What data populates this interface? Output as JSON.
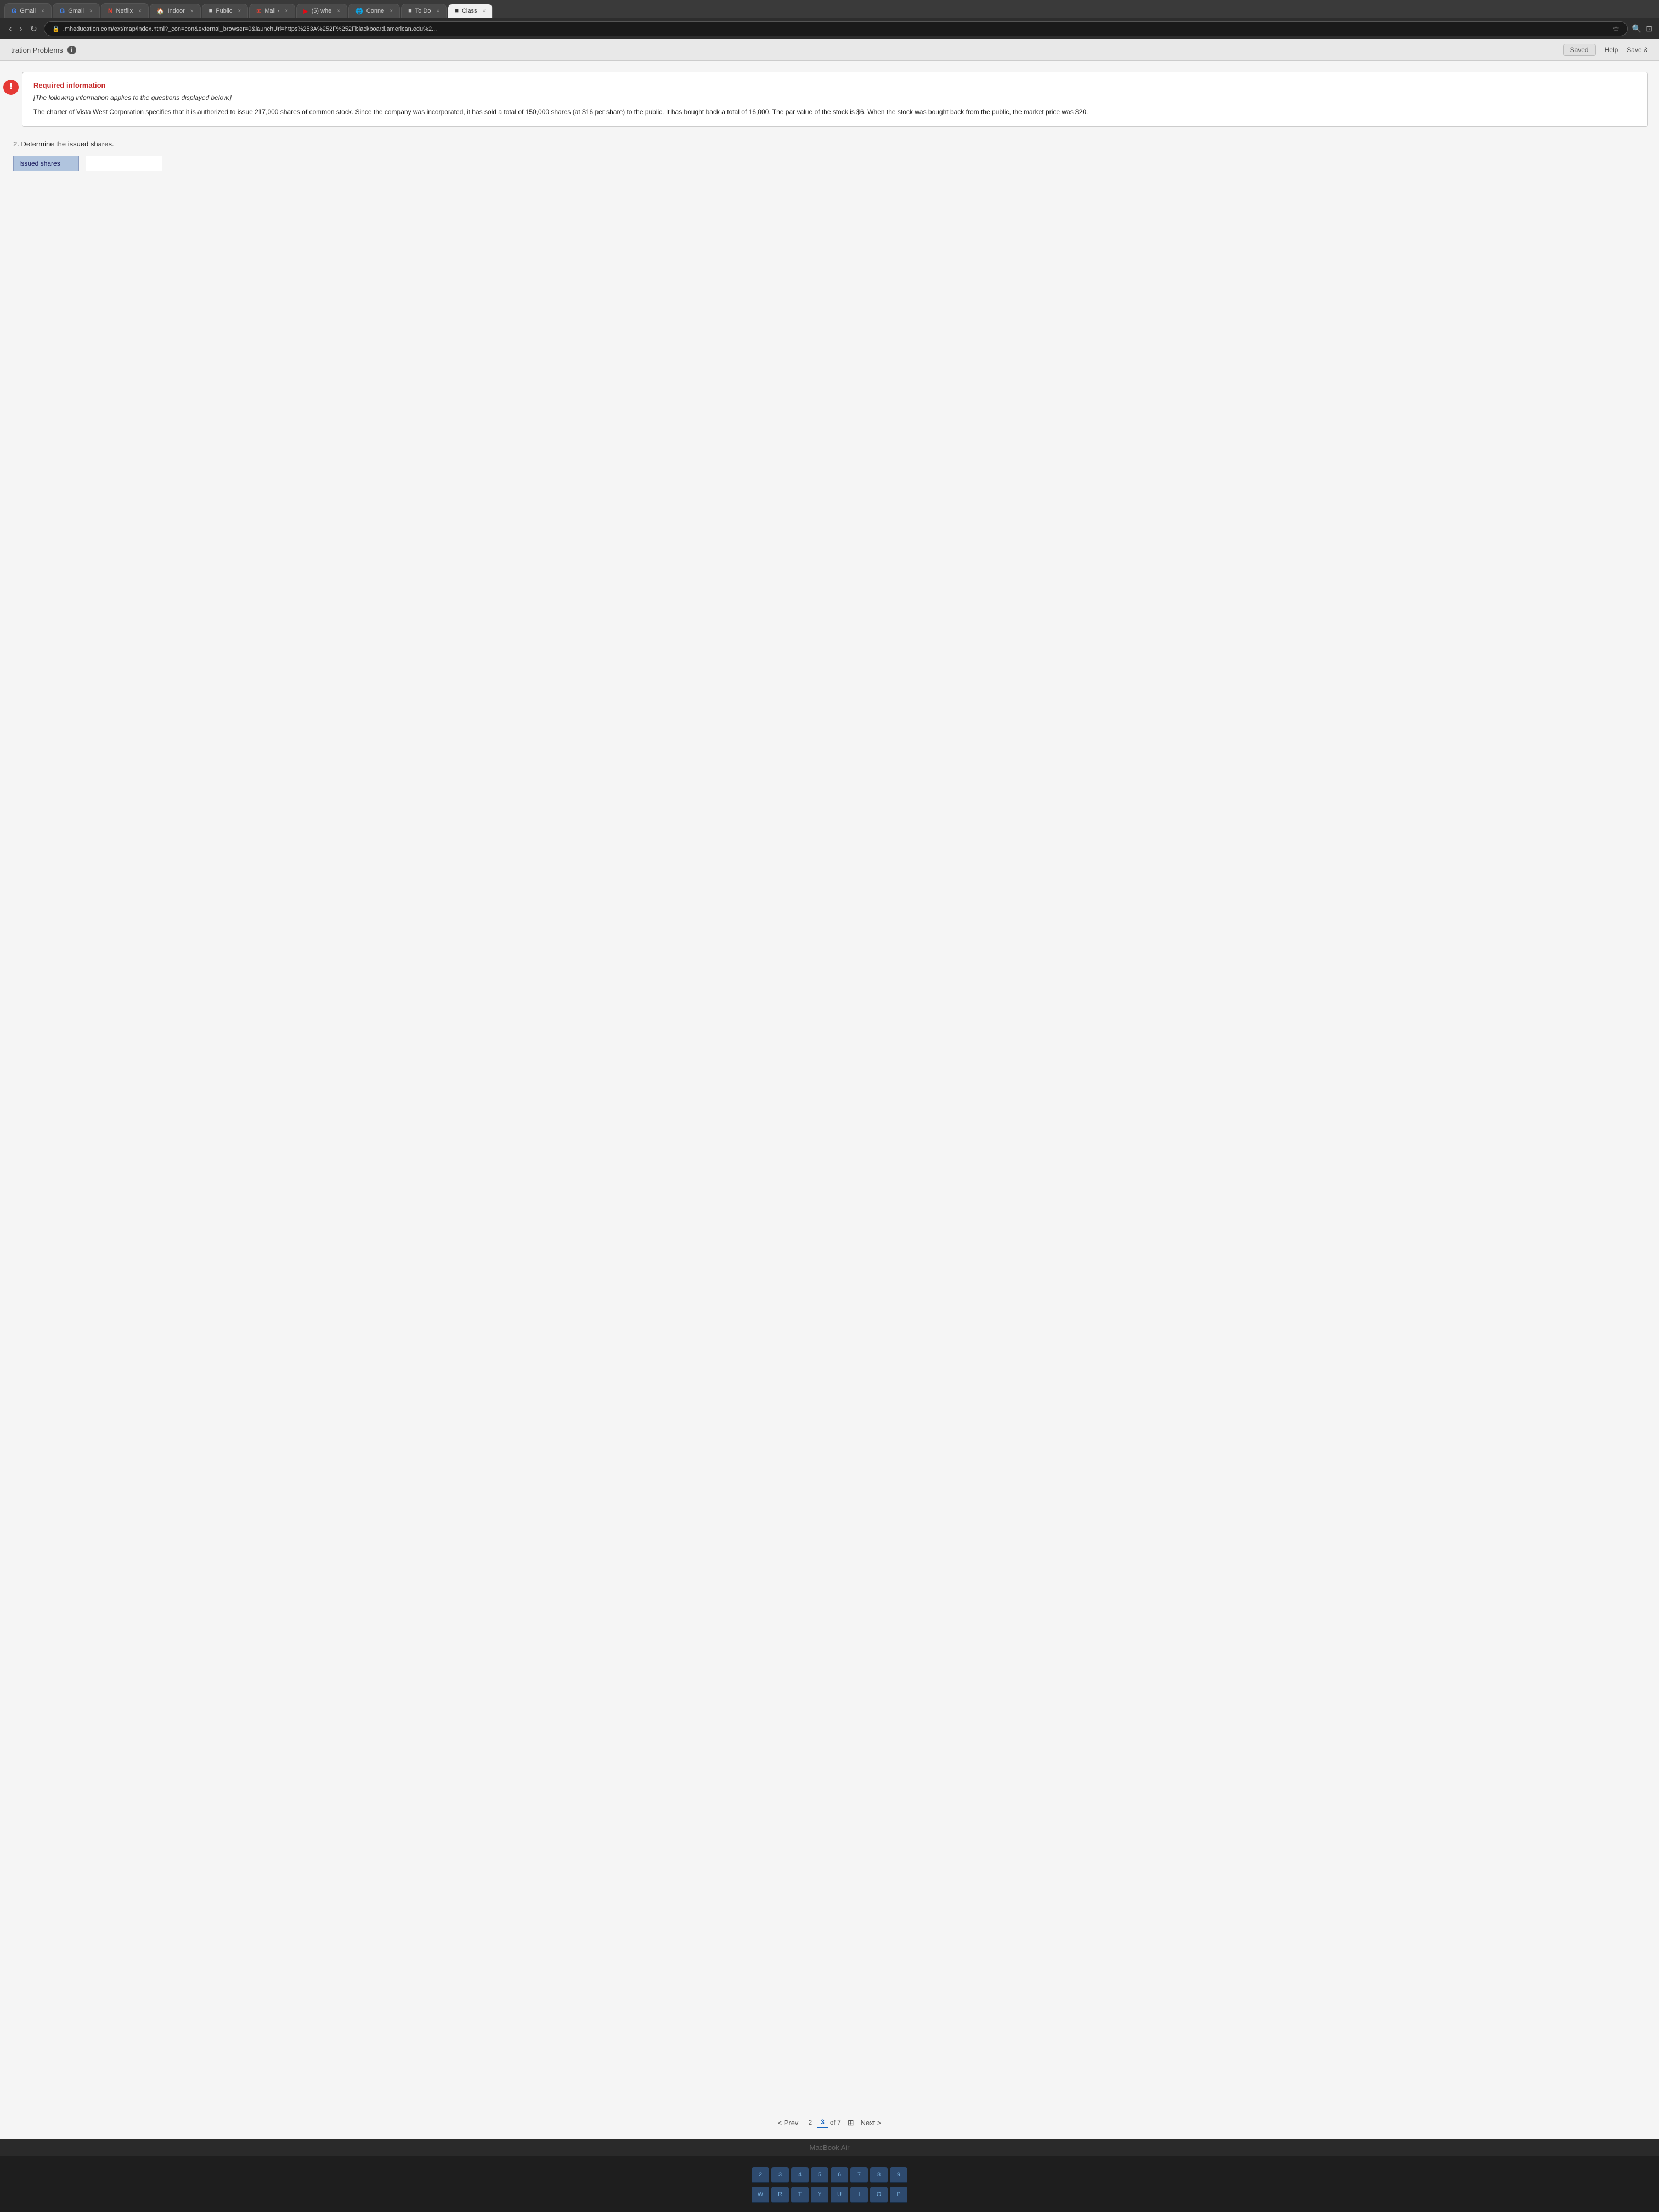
{
  "browser": {
    "tabs": [
      {
        "id": "gmail1",
        "label": "Gmail",
        "icon": "G",
        "active": false,
        "closable": true
      },
      {
        "id": "gmail2",
        "label": "Gmail",
        "icon": "G",
        "active": false,
        "closable": true
      },
      {
        "id": "netflix",
        "label": "Netflix",
        "icon": "N",
        "active": false,
        "closable": true
      },
      {
        "id": "indoor",
        "label": "Indoor",
        "icon": "🏠",
        "active": false,
        "closable": true
      },
      {
        "id": "public",
        "label": "Public",
        "icon": "■",
        "active": false,
        "closable": true
      },
      {
        "id": "mail",
        "label": "Mail ·",
        "icon": "✉",
        "active": false,
        "closable": true
      },
      {
        "id": "whe",
        "label": "(5) whe",
        "icon": "▶",
        "active": false,
        "closable": true
      },
      {
        "id": "conne",
        "label": "Conne",
        "icon": "🌐",
        "active": false,
        "closable": true
      },
      {
        "id": "todo",
        "label": "To Do",
        "icon": "■",
        "active": false,
        "closable": true
      },
      {
        "id": "class",
        "label": "Class",
        "icon": "■",
        "active": true,
        "closable": true
      }
    ],
    "address": ".mheducation.com/ext/map/index.html?_con=con&external_browser=0&launchUrl=https%253A%252F%252Fblackboard.american.edu%2..."
  },
  "app": {
    "title": "tration Problems",
    "info_icon": "ℹ",
    "saved_label": "Saved",
    "help_label": "Help",
    "save_label": "Save &"
  },
  "required_info": {
    "title": "Required information",
    "subtitle": "[The following information applies to the questions displayed below.]",
    "body": "The charter of Vista West Corporation specifies that it is authorized to issue 217,000 shares of common stock. Since the company was incorporated, it has sold a total of 150,000 shares (at $16 per share) to the public. It has bought back a total of 16,000. The par value of the stock is $6. When the stock was bought back from the public, the market price was $20."
  },
  "question": {
    "number": "2.",
    "text": "Determine the issued shares.",
    "field_label": "Issued shares",
    "field_placeholder": ""
  },
  "pagination": {
    "prev_label": "< Prev",
    "page_current": "3",
    "page_other": "2",
    "page_total": "of 7",
    "next_label": "Next >",
    "grid_icon": "⊞"
  },
  "macbook_label": "MacBook Air",
  "keyboard": {
    "rows": [
      [
        "2",
        "3",
        "4",
        "5",
        "6",
        "7",
        "8",
        "9"
      ],
      [
        "W",
        "R",
        "T",
        "Y",
        "U",
        "I",
        "O",
        "P"
      ]
    ]
  }
}
